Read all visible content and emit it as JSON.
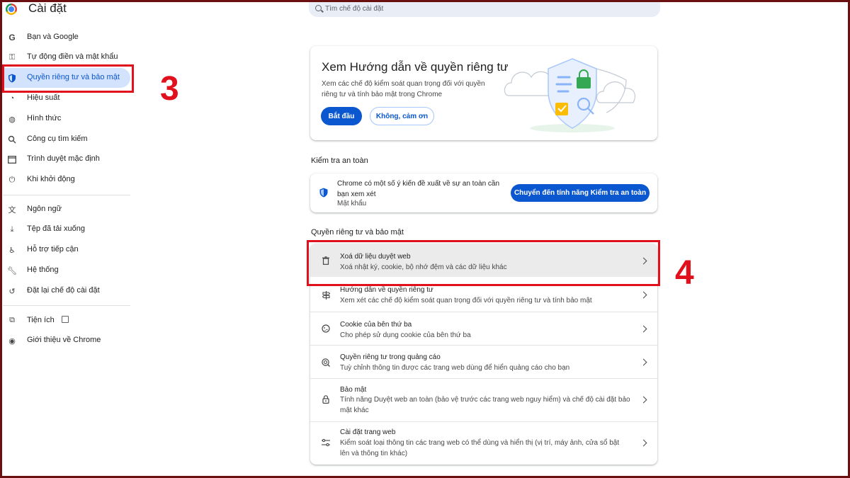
{
  "app": {
    "title": "Cài đặt"
  },
  "search": {
    "placeholder": "Tìm chế độ cài đặt"
  },
  "sidebar": {
    "items": [
      {
        "label": "Bạn và Google",
        "icon": "google-g-icon"
      },
      {
        "label": "Tự động điền và mật khẩu",
        "icon": "key-icon"
      },
      {
        "label": "Quyền riêng tư và bảo mật",
        "icon": "shield-icon",
        "active": true
      },
      {
        "label": "Hiệu suất",
        "icon": "speedometer-icon"
      },
      {
        "label": "Hình thức",
        "icon": "palette-icon"
      },
      {
        "label": "Công cụ tìm kiếm",
        "icon": "search-icon"
      },
      {
        "label": "Trình duyệt mặc định",
        "icon": "browser-window-icon"
      },
      {
        "label": "Khi khởi động",
        "icon": "power-icon"
      },
      {
        "label": "Ngôn ngữ",
        "icon": "translate-icon"
      },
      {
        "label": "Tệp đã tải xuống",
        "icon": "download-icon"
      },
      {
        "label": "Hỗ trợ tiếp cận",
        "icon": "accessibility-icon"
      },
      {
        "label": "Hệ thống",
        "icon": "wrench-icon"
      },
      {
        "label": "Đặt lại chế độ cài đặt",
        "icon": "reset-icon"
      },
      {
        "label": "Tiện ích",
        "icon": "puzzle-icon"
      },
      {
        "label": "Giới thiệu về Chrome",
        "icon": "chrome-icon"
      }
    ]
  },
  "annotations": {
    "step3": "3",
    "step4": "4",
    "highlight_color": "#e0101c"
  },
  "privacy_guide": {
    "title": "Xem Hướng dẫn về quyền riêng tư",
    "description": "Xem các chế độ kiểm soát quan trọng đối với quyền riêng tư và tính bảo mật trong Chrome",
    "start_label": "Bắt đầu",
    "dismiss_label": "Không, cảm ơn"
  },
  "safety_check": {
    "heading": "Kiểm tra an toàn",
    "message": "Chrome có một số ý kiến đề xuất về sự an toàn cần bạn xem xét",
    "detail": "Mật khẩu",
    "button_label": "Chuyển đến tính năng Kiểm tra an toàn"
  },
  "privacy_section": {
    "heading": "Quyền riêng tư và bảo mật",
    "rows": [
      {
        "title": "Xoá dữ liệu duyệt web",
        "subtitle": "Xoá nhật ký, cookie, bộ nhớ đệm và các dữ liệu khác",
        "icon": "trash-icon"
      },
      {
        "title": "Hướng dẫn về quyền riêng tư",
        "subtitle": "Xem xét các chế độ kiểm soát quan trọng đối với quyền riêng tư và tính bảo mật",
        "icon": "signpost-icon"
      },
      {
        "title": "Cookie của bên thứ ba",
        "subtitle": "Cho phép sử dụng cookie của bên thứ ba",
        "icon": "cookie-icon"
      },
      {
        "title": "Quyền riêng tư trong quảng cáo",
        "subtitle": "Tuỳ chỉnh thông tin được các trang web dùng để hiển quảng cáo cho bạn",
        "icon": "ad-privacy-icon"
      },
      {
        "title": "Bảo mật",
        "subtitle": "Tính năng Duyệt web an toàn (bảo vệ trước các trang web nguy hiểm) và chế độ cài đặt bảo mật khác",
        "icon": "lock-icon"
      },
      {
        "title": "Cài đặt trang web",
        "subtitle": "Kiểm soát loại thông tin các trang web có thể dùng và hiển thị (vị trí, máy ảnh, cửa sổ bật lên và thông tin khác)",
        "icon": "sliders-icon"
      }
    ]
  }
}
